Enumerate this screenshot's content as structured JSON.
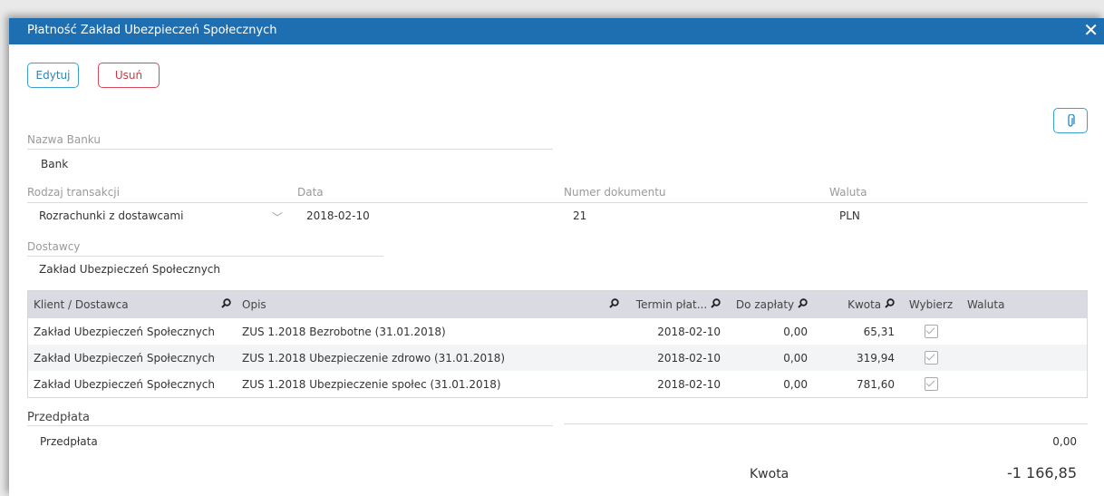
{
  "window": {
    "title": "Płatność Zakład Ubezpieczeń Społecznych"
  },
  "toolbar": {
    "edit_label": "Edytuj",
    "delete_label": "Usuń"
  },
  "form": {
    "bank_label": "Nazwa Banku",
    "bank_value": "Bank",
    "type_label": "Rodzaj transakcji",
    "type_value": "Rozrachunki z dostawcami",
    "date_label": "Data",
    "date_value": "2018-02-10",
    "docnum_label": "Numer dokumentu",
    "docnum_value": "21",
    "currency_label": "Waluta",
    "currency_value": "PLN",
    "supplier_label": "Dostawcy",
    "supplier_value": "Zakład Ubezpieczeń Społecznych"
  },
  "table": {
    "columns": [
      "Klient / Dostawca",
      "Opis",
      "Termin płat...",
      "Do zapłaty",
      "Kwota",
      "Wybierz",
      "Waluta"
    ],
    "rows": [
      {
        "client": "Zakład Ubezpieczeń Społecznych",
        "desc": "ZUS 1.2018 Bezrobotne (31.01.2018)",
        "due": "2018-02-10",
        "topay": "0,00",
        "amount": "65,31",
        "selected": true,
        "currency": ""
      },
      {
        "client": "Zakład Ubezpieczeń Społecznych",
        "desc": "ZUS 1.2018 Ubezpieczenie zdrowo (31.01.2018)",
        "due": "2018-02-10",
        "topay": "0,00",
        "amount": "319,94",
        "selected": true,
        "currency": ""
      },
      {
        "client": "Zakład Ubezpieczeń Społecznych",
        "desc": "ZUS 1.2018 Ubezpieczenie społec (31.01.2018)",
        "due": "2018-02-10",
        "topay": "0,00",
        "amount": "781,60",
        "selected": true,
        "currency": ""
      }
    ]
  },
  "prepayment": {
    "section_label": "Przedpłata",
    "row_label": "Przedpłata",
    "row_value": "0,00"
  },
  "total": {
    "label": "Kwota",
    "value": "-1 166,85"
  },
  "icons": {
    "close": "close-icon",
    "attach": "paperclip-icon",
    "search": "search-icon",
    "dropdown": "chevron-down-icon",
    "check": "checkbox-icon"
  },
  "colors": {
    "titlebar": "#1e6fb1",
    "edit_border": "#3aa0cf",
    "delete_border": "#d44a56",
    "table_header": "#dadbe2"
  }
}
